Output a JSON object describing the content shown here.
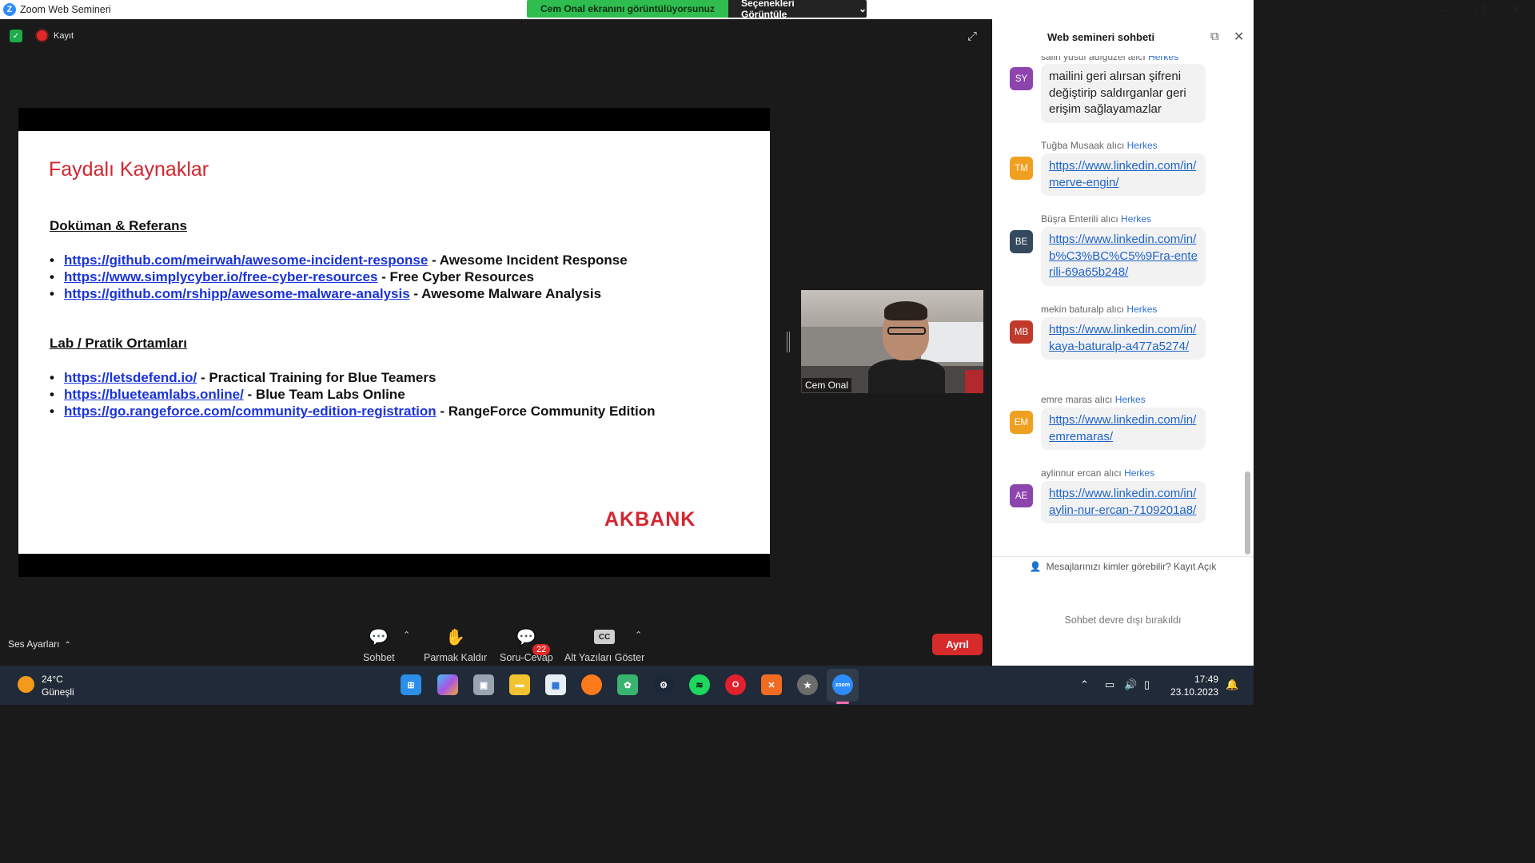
{
  "window": {
    "title": "Zoom Web Semineri",
    "share_status": "Cem Onal ekranını görüntülüyorsunuz",
    "view_options": "Seçenekleri Görüntüle",
    "minimize": "–",
    "maximize": "❐",
    "close": "✕"
  },
  "meeting": {
    "recording_label": "Kayıt"
  },
  "slide": {
    "title": "Faydalı Kaynaklar",
    "section1_title": "Doküman & Referans",
    "section1_items": [
      {
        "link": "https://github.com/meirwah/awesome-incident-response",
        "desc": " - Awesome Incident Response"
      },
      {
        "link": "https://www.simplycyber.io/free-cyber-resources",
        "desc": " - Free Cyber Resources"
      },
      {
        "link": "https://github.com/rshipp/awesome-malware-analysis",
        "desc": " - Awesome Malware Analysis"
      }
    ],
    "section2_title": "Lab / Pratik Ortamları",
    "section2_items": [
      {
        "link": "https://letsdefend.io/",
        "desc": " - Practical Training for Blue Teamers"
      },
      {
        "link": "https://blueteamlabs.online/",
        "desc": " - Blue Team Labs Online"
      },
      {
        "link": "https://go.rangeforce.com/community-edition-registration",
        "desc": " - RangeForce Community Edition"
      }
    ],
    "logo": "AKBANK"
  },
  "video": {
    "participant_name": "Cem Onal"
  },
  "controls": {
    "audio_settings": "Ses Ayarları",
    "chat": "Sohbet",
    "raise_hand": "Parmak Kaldır",
    "qa": "Soru-Cevap",
    "qa_badge": "22",
    "captions": "Alt Yazıları Göster",
    "captions_icon_text": "CC",
    "leave": "Ayrıl"
  },
  "chat": {
    "title": "Web semineri sohbeti",
    "messages": [
      {
        "sender": "salih yusuf adıgüzel alıcı",
        "to": "Herkes",
        "initials": "SY",
        "color": "#8e44ad",
        "text": "mailini geri alırsan şifreni değiştirip saldırganlar geri erişim sağlayamazlar",
        "is_link": false
      },
      {
        "sender": "Tuğba Musaak alıcı",
        "to": "Herkes",
        "initials": "TM",
        "color": "#f0a020",
        "text": "https://www.linkedin.com/in/merve-engin/",
        "is_link": true
      },
      {
        "sender": "Büşra Enterili alıcı",
        "to": "Herkes",
        "initials": "BE",
        "color": "#34495e",
        "text": "https://www.linkedin.com/in/b%C3%BC%C5%9Fra-enterili-69a65b248/",
        "is_link": true
      },
      {
        "sender": "mekin baturalp alıcı",
        "to": "Herkes",
        "initials": "MB",
        "color": "#c0392b",
        "text": "https://www.linkedin.com/in/kaya-baturalp-a477a5274/",
        "is_link": true
      },
      {
        "sender": "emre maras alıcı",
        "to": "Herkes",
        "initials": "EM",
        "color": "#f0a020",
        "text": "https://www.linkedin.com/in/emremaras/",
        "is_link": true
      },
      {
        "sender": "aylinnur ercan alıcı",
        "to": "Herkes",
        "initials": "AE",
        "color": "#8e44ad",
        "text": "https://www.linkedin.com/in/aylin-nur-ercan-7109201a8/",
        "is_link": true
      }
    ],
    "privacy_notice": "Mesajlarınızı kimler görebilir? Kayıt Açık",
    "disabled_notice": "Sohbet devre dışı bırakıldı"
  },
  "taskbar": {
    "temperature": "24°C",
    "weather": "Güneşli",
    "time": "17:49",
    "date": "23.10.2023"
  }
}
